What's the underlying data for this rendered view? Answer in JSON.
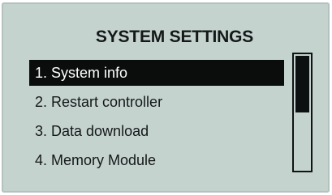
{
  "screen": {
    "title": "SYSTEM SETTINGS",
    "menu": {
      "items": [
        {
          "label": "1. System info",
          "selected": true
        },
        {
          "label": "2. Restart controller",
          "selected": false
        },
        {
          "label": "3. Data download",
          "selected": false
        },
        {
          "label": "4. Memory Module",
          "selected": false
        }
      ]
    },
    "scrollbar": {
      "thumb_fraction": 0.5,
      "position_fraction": 0.0
    },
    "colors": {
      "background": "#c5d3cf",
      "text": "#141818",
      "selection": "#0b0d0d",
      "selection_text": "#ffffff"
    }
  }
}
